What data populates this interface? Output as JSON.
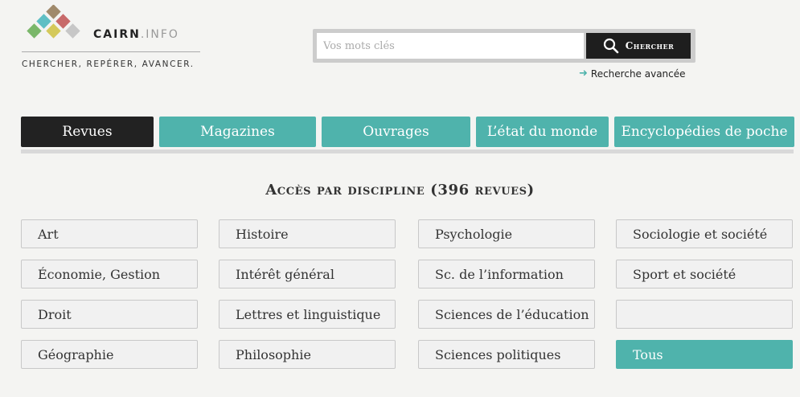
{
  "brand": {
    "name": "CAIRN",
    "suffix": ".INFO",
    "tagline": "CHERCHER, REPÉRER, AVANCER.",
    "colors": [
      "#a08a6b",
      "#c86a6a",
      "#5fbfc4",
      "#7ab76a",
      "#d4c95a",
      "#c7c7c7"
    ]
  },
  "search": {
    "placeholder": "Vos mots clés",
    "button_label": "Chercher",
    "advanced_label": "Recherche avancée"
  },
  "tabs": [
    {
      "label": "Revues",
      "active": true
    },
    {
      "label": "Magazines",
      "active": false
    },
    {
      "label": "Ouvrages",
      "active": false
    },
    {
      "label": "L’état du monde",
      "active": false
    },
    {
      "label": "Encyclopédies de poche",
      "active": false
    }
  ],
  "heading": "Accès par discipline (396 revues)",
  "disciplines": [
    [
      "Art",
      "Histoire",
      "Psychologie",
      "Sociologie et société"
    ],
    [
      "Économie, Gestion",
      "Intérêt général",
      "Sc. de l’information",
      "Sport et société"
    ],
    [
      "Droit",
      "Lettres et linguistique",
      "Sciences de l’éducation",
      ""
    ],
    [
      "Géographie",
      "Philosophie",
      "Sciences politiques",
      "Tous"
    ]
  ],
  "accent_color": "#4fb3ac"
}
